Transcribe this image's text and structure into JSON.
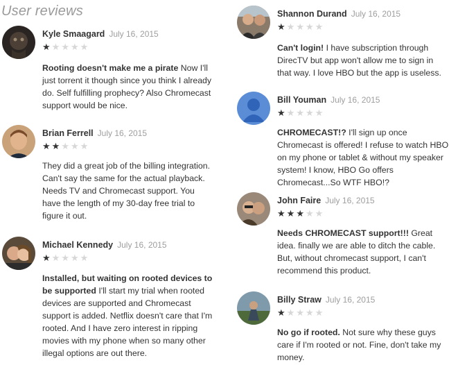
{
  "header": {
    "title": "User reviews"
  },
  "reviews": [
    {
      "author": "Kyle Smaagard",
      "date": "July 16, 2015",
      "rating": 1,
      "title": "Rooting doesn't make me a pirate",
      "text": "Now I'll just torrent it though since you think I already do. Self fulfilling prophecy? Also Chromecast support would be nice."
    },
    {
      "author": "Brian Ferrell",
      "date": "July 16, 2015",
      "rating": 2,
      "title": "",
      "text": "They did a great job of the billing integration. Can't say the same for the actual playback. Needs TV and Chromecast support. You have the length of my 30-day free trial to figure it out."
    },
    {
      "author": "Michael Kennedy",
      "date": "July 16, 2015",
      "rating": 1,
      "title": "Installed, but waiting on rooted devices to be supported",
      "text": "I'll start my trial when rooted devices are supported and Chromecast support is added. Netflix doesn't care that I'm rooted. And I have zero interest in ripping movies with my phone when so many other illegal options are out there."
    },
    {
      "author": "Shannon Durand",
      "date": "July 16, 2015",
      "rating": 1,
      "title": "Can't login!",
      "text": "I have subscription through DirecTV but app won't allow me to sign in that way. I love HBO but the app is useless."
    },
    {
      "author": "Bill Youman",
      "date": "July 16, 2015",
      "rating": 1,
      "title": "CHROMECAST!?",
      "text": "I'll sign up once Chromecast is offered! I refuse to watch HBO on my phone or tablet & without my speaker system! I know, HBO Go offers Chromecast...So WTF HBO!?"
    },
    {
      "author": "John Faire",
      "date": "July 16, 2015",
      "rating": 3,
      "title": "Needs CHROMECAST support!!!",
      "text": "Great idea. finally we are able to ditch the cable. But, without chromecast support, I can't recommend this product."
    },
    {
      "author": "Billy Straw",
      "date": "July 16, 2015",
      "rating": 1,
      "title": "No go if rooted.",
      "text": "Not sure why these guys care if I'm rooted or not. Fine, don't take my money."
    }
  ]
}
